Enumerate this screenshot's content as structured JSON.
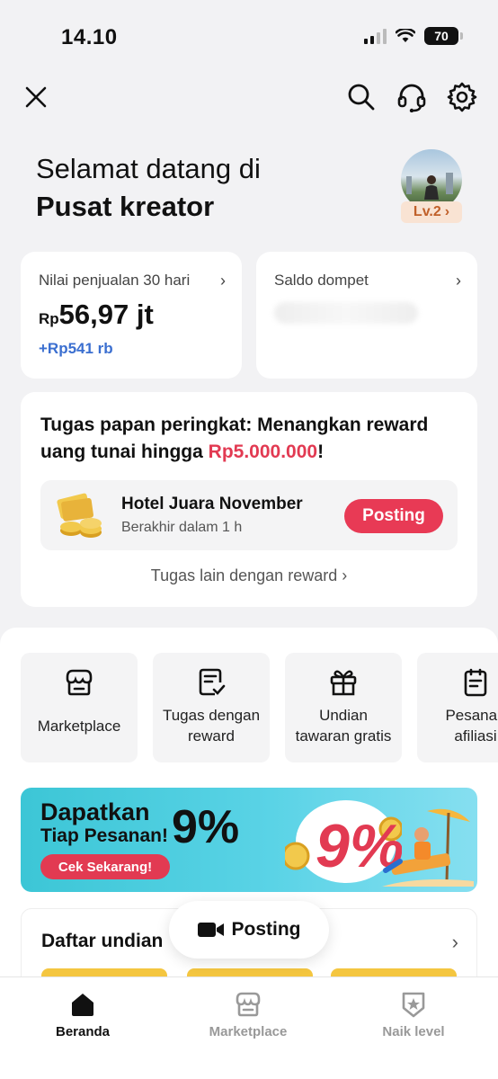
{
  "status_bar": {
    "time": "14.10",
    "battery": "70"
  },
  "topbar": {
    "icons": [
      "close-icon",
      "search-icon",
      "headset-icon",
      "settings-icon"
    ]
  },
  "header": {
    "greeting_line1": "Selamat datang di",
    "greeting_line2": "Pusat kreator",
    "level": "Lv.2"
  },
  "stats": {
    "sales": {
      "label": "Nilai penjualan 30 hari",
      "currency": "Rp",
      "value": "56,97 jt",
      "delta": "+Rp541 rb"
    },
    "wallet": {
      "label": "Saldo dompet"
    }
  },
  "task": {
    "title_part1": "Tugas papan peringkat: Menangkan reward uang tunai hingga ",
    "title_highlight": "Rp5.000.000",
    "title_end": "!",
    "item_name": "Hotel Juara November",
    "item_sub": "Berakhir dalam 1 h",
    "item_button": "Posting",
    "more_link": "Tugas lain dengan reward"
  },
  "tiles": [
    {
      "line1": "Marketplace",
      "line2": "",
      "icon": "store-icon"
    },
    {
      "line1": "Tugas dengan",
      "line2": "reward",
      "icon": "task-icon"
    },
    {
      "line1": "Undian",
      "line2": "tawaran gratis",
      "icon": "gift-icon"
    },
    {
      "line1": "Pesanan",
      "line2": "afiliasi",
      "icon": "orders-icon"
    }
  ],
  "banner": {
    "line1": "Dapatkan",
    "line2": "Tiap Pesanan!",
    "percent": "9%",
    "cta": "Cek Sekarang!",
    "graphic_percent": "9%"
  },
  "draw_section": {
    "title": "Daftar undian"
  },
  "fab": {
    "label": "Posting"
  },
  "bottom_nav": {
    "items": [
      {
        "label": "Beranda",
        "active": true
      },
      {
        "label": "Marketplace",
        "active": false
      },
      {
        "label": "Naik level",
        "active": false
      }
    ]
  },
  "colors": {
    "accent": "#e83a55",
    "delta_blue": "#3b6fd0",
    "level_bg": "#f9e3d3",
    "level_text": "#c0602a",
    "banner_bg": "#5ad3e6"
  }
}
